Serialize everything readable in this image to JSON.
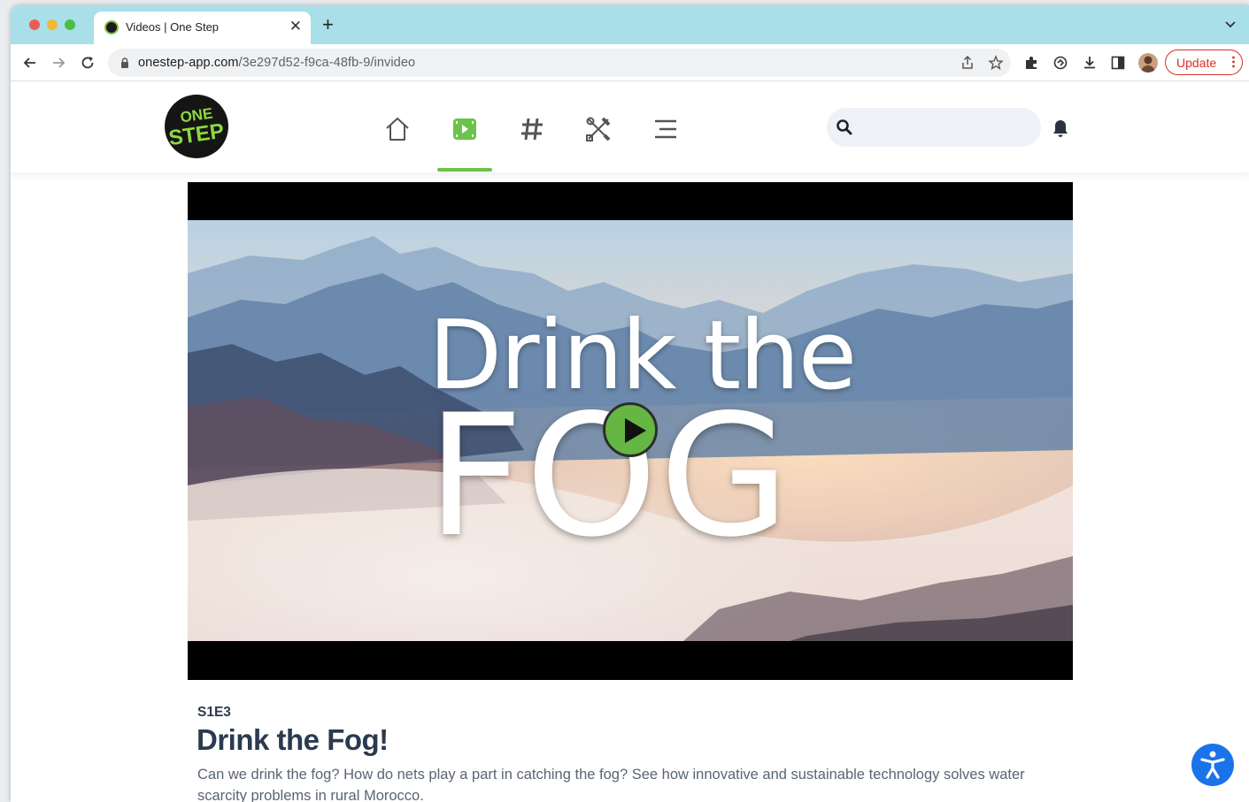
{
  "browser": {
    "tab_title": "Videos | One Step",
    "url_host": "onestep-app.com",
    "url_path": "/3e297d52-f9ca-48fb-9/invideo",
    "update_label": "Update"
  },
  "site": {
    "logo_line1": "ONE",
    "logo_line2": "STEP",
    "search_placeholder": "",
    "nav": [
      "home-icon",
      "video-icon",
      "hashtag-icon",
      "tools-icon",
      "menu-icon"
    ],
    "active_nav": "video-icon",
    "accent_color": "#6cc24a"
  },
  "video": {
    "thumb_line1": "Drink the",
    "thumb_line2": "FOG"
  },
  "episode": {
    "code": "S1E3",
    "title": "Drink the Fog!",
    "description": "Can we drink the fog? How do nets play a part in catching the fog? See how innovative and sustainable technology solves water scarcity problems in rural Morocco."
  }
}
